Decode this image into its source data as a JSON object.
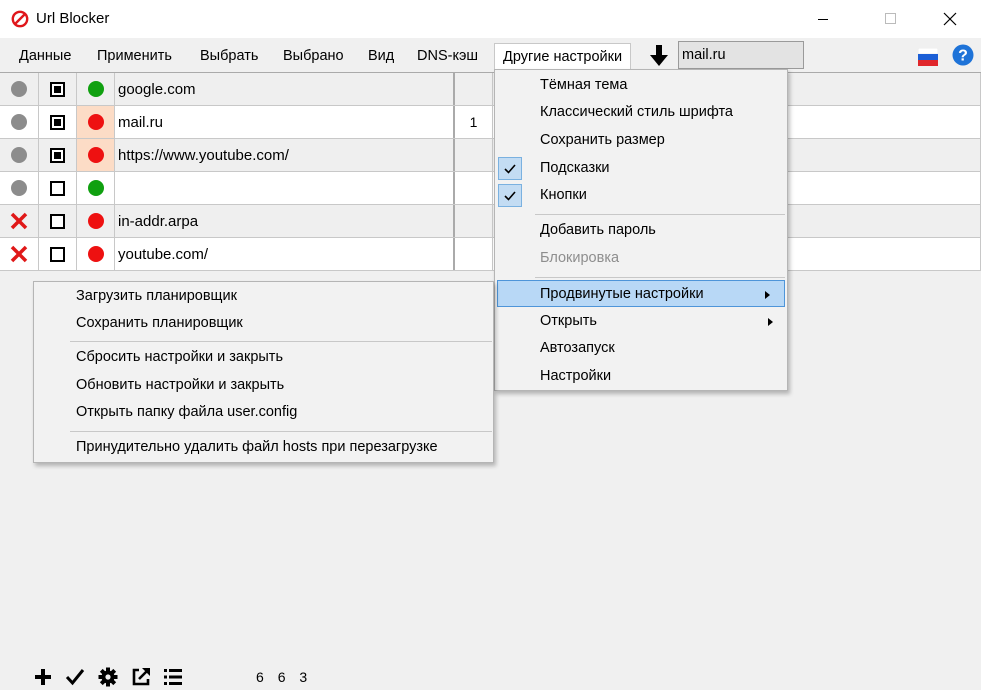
{
  "window": {
    "title": "Url Blocker",
    "icon": "prohibited-icon",
    "controls": [
      "minimize",
      "maximize",
      "close"
    ]
  },
  "menubar": {
    "items": [
      "Данные",
      "Применить",
      "Выбрать",
      "Выбрано",
      "Вид",
      "DNS-кэш",
      "Другие настройки"
    ],
    "active": "Другие настройки",
    "search_value": "mail.ru",
    "icons": [
      "download-icon",
      "russian-flag-icon",
      "help-icon"
    ]
  },
  "grid": {
    "rows": [
      {
        "status": "gray",
        "checked": true,
        "state": "green",
        "url": "google.com",
        "count": ""
      },
      {
        "status": "gray",
        "checked": true,
        "state": "red",
        "url": "mail.ru",
        "count": "1"
      },
      {
        "status": "gray",
        "checked": true,
        "state": "red",
        "url": "https://www.youtube.com/",
        "count": ""
      },
      {
        "status": "gray",
        "checked": false,
        "state": "green",
        "url": "",
        "count": ""
      },
      {
        "status": "x",
        "checked": false,
        "state": "red",
        "url": "in-addr.arpa",
        "count": ""
      },
      {
        "status": "x",
        "checked": false,
        "state": "red",
        "url": "youtube.com/",
        "count": ""
      }
    ]
  },
  "dropdown": {
    "items": [
      {
        "label": "Тёмная тема",
        "checked": false
      },
      {
        "label": "Классический стиль шрифта",
        "checked": false
      },
      {
        "label": "Сохранить размер",
        "checked": false
      },
      {
        "label": "Подсказки",
        "checked": true
      },
      {
        "label": "Кнопки",
        "checked": true
      },
      {
        "label": "Добавить пароль",
        "checked": false
      },
      {
        "label": "Блокировка",
        "disabled": true
      },
      {
        "label": "Продвинутые настройки",
        "highlighted": true,
        "submenu": true
      },
      {
        "label": "Открыть",
        "submenu": true
      },
      {
        "label": "Автозапуск"
      },
      {
        "label": "Настройки"
      }
    ]
  },
  "submenu": {
    "items": [
      "Загрузить планировщик",
      "Сохранить планировщик",
      "Сбросить настройки и закрыть",
      "Обновить настройки и закрыть",
      "Открыть папку файла user.config",
      "Принудительно удалить файл hosts при перезагрузке"
    ]
  },
  "toolbar": {
    "icons": [
      "add-icon",
      "check-icon",
      "gear-icon",
      "external-link-icon",
      "list-icon"
    ],
    "counts": [
      "6",
      "6",
      "3"
    ]
  },
  "colors": {
    "highlight": "#b8d8f6",
    "highlight_border": "#4e95d9",
    "selected_cell": "#fcdcc6",
    "status_red": "#ee1111",
    "status_green": "#10a010"
  }
}
